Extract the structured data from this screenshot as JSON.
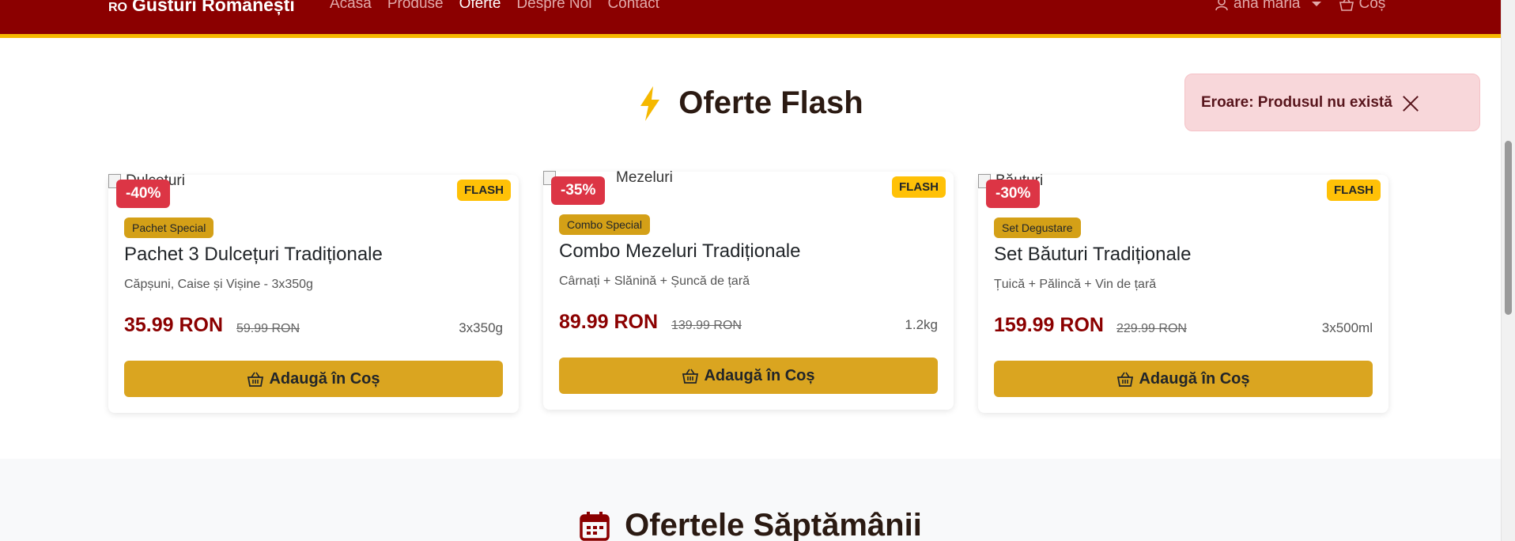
{
  "navbar": {
    "brand_flag": "RO",
    "brand_name": "Gusturi Românești",
    "links": [
      "Acasa",
      "Produse",
      "Oferte",
      "Despre Noi",
      "Contact"
    ],
    "active_link": "Oferte",
    "user": "ana maria",
    "cart": "Coș"
  },
  "flash_section": {
    "title": "Oferte Flash",
    "icon": "bolt-icon",
    "icon_color": "#f5b800"
  },
  "toast": {
    "message": "Eroare: Produsul nu există",
    "close_icon": "close-icon"
  },
  "products": [
    {
      "img_alt": "Dulcețuri",
      "discount": "-40%",
      "badge": "FLASH",
      "tag": "Pachet Special",
      "title": "Pachet 3 Dulcețuri Tradiționale",
      "desc": "Căpșuni, Caise și Vișine - 3x350g",
      "price": "35.99 RON",
      "old_price": "59.99 RON",
      "weight": "3x350g",
      "button": "Adaugă în Coș"
    },
    {
      "img_alt": "Mezeluri",
      "discount": "-35%",
      "badge": "FLASH",
      "tag": "Combo Special",
      "title": "Combo Mezeluri Tradiționale",
      "desc": "Cârnați + Slănină + Șuncă de țară",
      "price": "89.99 RON",
      "old_price": "139.99 RON",
      "weight": "1.2kg",
      "button": "Adaugă în Coș"
    },
    {
      "img_alt": "Băuturi",
      "discount": "-30%",
      "badge": "FLASH",
      "tag": "Set Degustare",
      "title": "Set Băuturi Tradiționale",
      "desc": "Țuică + Pălincă + Vin de țară",
      "price": "159.99 RON",
      "old_price": "229.99 RON",
      "weight": "3x500ml",
      "button": "Adaugă în Coș"
    }
  ],
  "weekly_section": {
    "title": "Ofertele Săptămânii",
    "icon": "calendar-icon"
  },
  "colors": {
    "navbar": "#8b0000",
    "accent": "#f5b800",
    "price": "#8b0000",
    "button": "#daa520",
    "discount": "#dc3545",
    "toast_bg": "#f8d7da"
  }
}
